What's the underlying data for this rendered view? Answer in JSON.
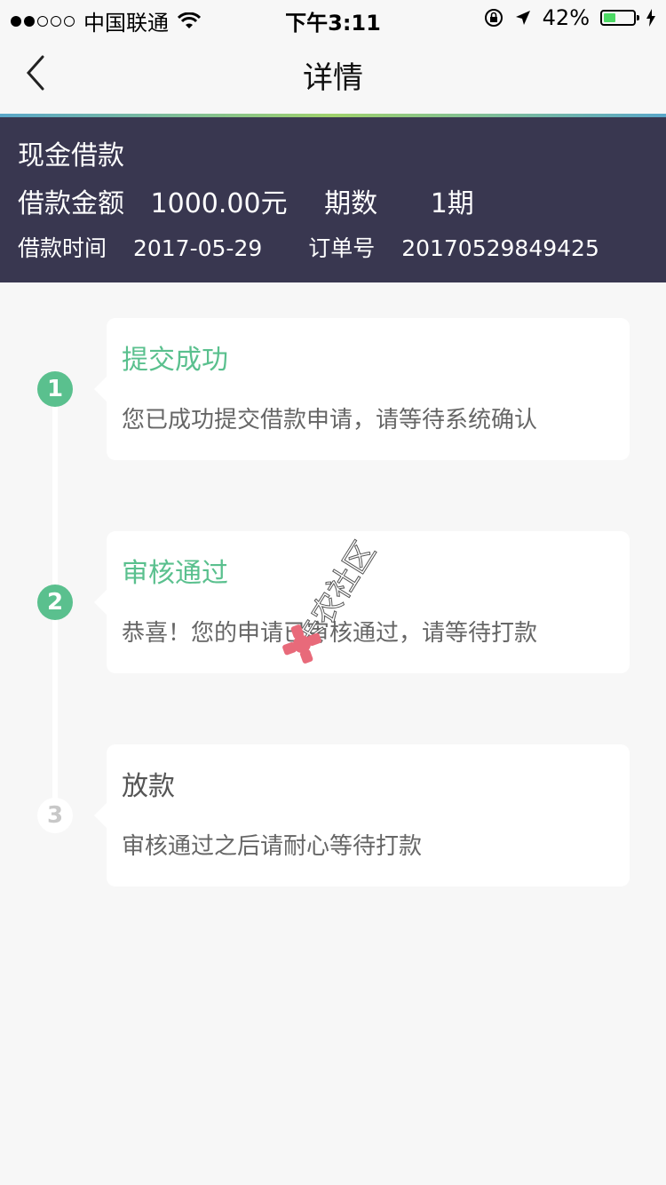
{
  "status_bar": {
    "carrier": "中国联通",
    "time": "下午3:11",
    "battery_text": "42%",
    "battery_level": 0.42
  },
  "nav": {
    "title": "详情"
  },
  "loan": {
    "type": "现金借款",
    "amount_label": "借款金额",
    "amount": "1000.00元",
    "periods_label": "期数",
    "periods": "1期",
    "time_label": "借款时间",
    "time": "2017-05-29",
    "order_label": "订单号",
    "order_no": "20170529849425"
  },
  "steps": [
    {
      "number": "1",
      "title": "提交成功",
      "desc": "您已成功提交借款申请，请等待系统确认",
      "status": "done"
    },
    {
      "number": "2",
      "title": "审核通过",
      "desc": "恭喜！您的申请已审核通过，请等待打款",
      "status": "done"
    },
    {
      "number": "3",
      "title": "放款",
      "desc": "审核通过之后请耐心等待打款",
      "status": "pending"
    }
  ],
  "watermark": {
    "text": "卡农社区"
  },
  "colors": {
    "header_bg": "#393750",
    "success": "#5ac08e",
    "page_bg": "#f7f7f7"
  }
}
